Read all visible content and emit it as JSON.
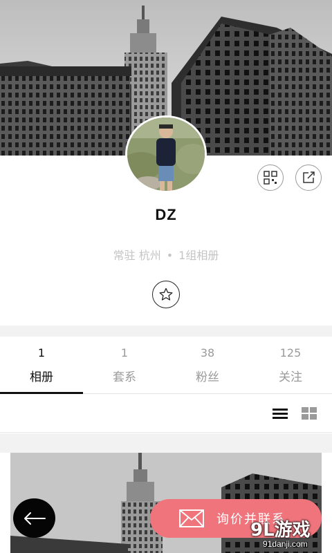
{
  "profile": {
    "name": "DZ",
    "location": "常驻 杭州",
    "separator": "•",
    "albums_summary": "1组相册"
  },
  "tabs": [
    {
      "count": "1",
      "label": "相册",
      "active": true
    },
    {
      "count": "1",
      "label": "套系",
      "active": false
    },
    {
      "count": "38",
      "label": "粉丝",
      "active": false
    },
    {
      "count": "125",
      "label": "关注",
      "active": false
    }
  ],
  "message_button": {
    "label": "询价并联系"
  },
  "watermark": {
    "brand": "9L游戏",
    "domain": "91danji.com"
  },
  "icons": {
    "qr": "qr-code-icon",
    "share": "share-icon",
    "favorite": "star-icon",
    "list_view": "list-view-icon",
    "grid_view": "grid-view-icon",
    "back": "arrow-left-icon",
    "message": "envelope-icon"
  },
  "colors": {
    "accent": "#f0747c",
    "active_tab": "#111111",
    "inactive_tab": "#9a9a9a"
  }
}
